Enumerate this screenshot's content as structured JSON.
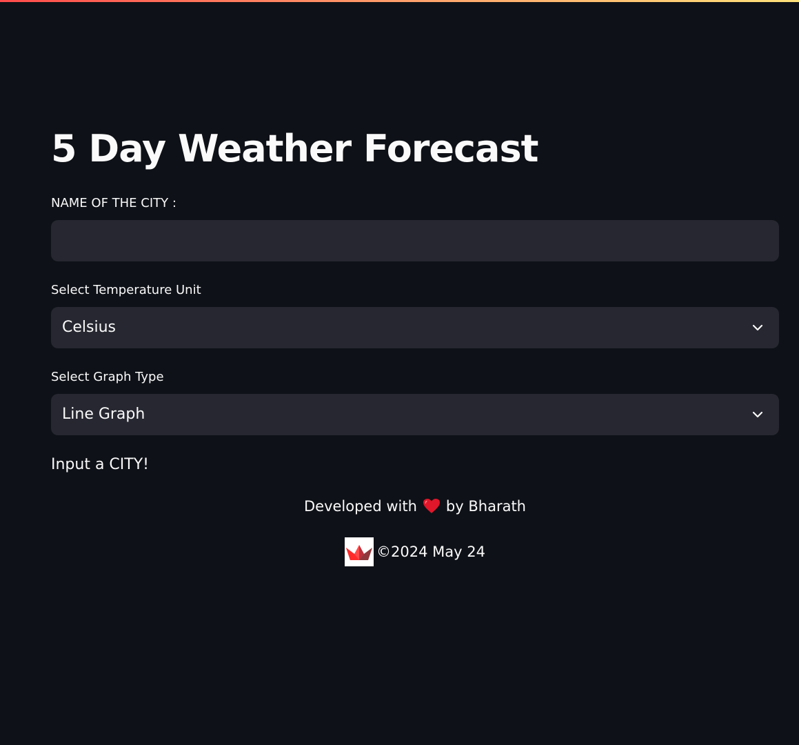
{
  "app": {
    "title": "5 Day Weather Forecast",
    "accent_gradient": [
      "#ff4b4b",
      "#ffe27a"
    ],
    "background": "#0e1117"
  },
  "city_input": {
    "label": "NAME OF THE CITY :",
    "value": "",
    "placeholder": ""
  },
  "temperature_unit": {
    "label": "Select Temperature Unit",
    "selected": "Celsius"
  },
  "graph_type": {
    "label": "Select Graph Type",
    "selected": "Line Graph"
  },
  "status_message": "Input a CITY!",
  "footer": {
    "developed_prefix": "Developed with",
    "developed_suffix": "by Bharath",
    "heart_icon": "heart-icon",
    "logo_icon": "streamlit-logo",
    "copyright": "©2024 May 24"
  }
}
